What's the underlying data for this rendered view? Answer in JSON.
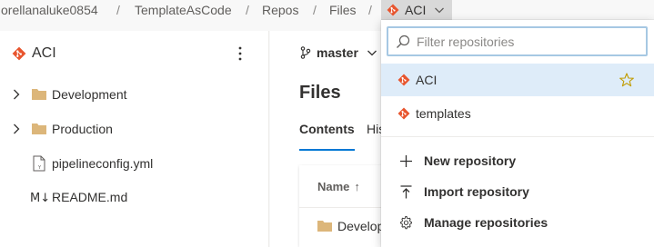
{
  "breadcrumb": {
    "items": [
      "orellanaluke0854",
      "TemplateAsCode",
      "Repos",
      "Files"
    ],
    "separator": "/",
    "current_repo": "ACI"
  },
  "sidebar": {
    "repo_name": "ACI",
    "more_icon": "more-vertical-icon",
    "tree": [
      {
        "label": "Development",
        "type": "folder",
        "expandable": true
      },
      {
        "label": "Production",
        "type": "folder",
        "expandable": true
      },
      {
        "label": "pipelineconfig.yml",
        "type": "yml-file",
        "expandable": false
      },
      {
        "label": "README.md",
        "type": "markdown-file",
        "expandable": false
      }
    ]
  },
  "main": {
    "branch": "master",
    "title": "Files",
    "tabs": [
      "Contents",
      "His"
    ],
    "column_header": "Name",
    "sort_indicator": "↑",
    "first_row": "Develop"
  },
  "dropdown": {
    "search_placeholder": "Filter repositories",
    "repos": [
      {
        "name": "ACI",
        "selected": true,
        "favorite_icon": "star-outline-icon"
      },
      {
        "name": "templates",
        "selected": false
      }
    ],
    "actions": [
      {
        "label": "New repository",
        "icon": "plus-icon"
      },
      {
        "label": "Import repository",
        "icon": "import-icon"
      },
      {
        "label": "Manage repositories",
        "icon": "gear-icon"
      }
    ]
  },
  "colors": {
    "git_orange": "#e8552e",
    "folder": "#dcb67a",
    "accent": "#0078d4",
    "selected_row": "#deecf9",
    "breadcrumb_active_bg": "#d9d9d9"
  }
}
